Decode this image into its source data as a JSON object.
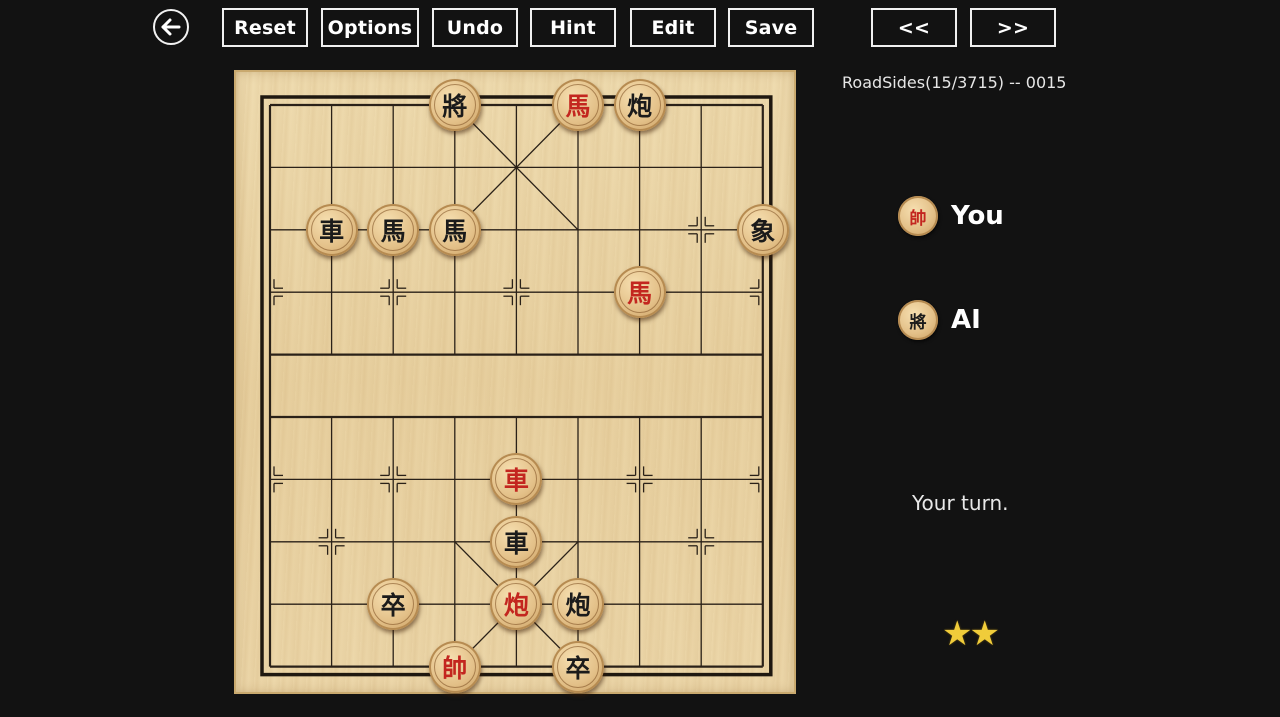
{
  "toolbar": {
    "buttons": [
      "Reset",
      "Options",
      "Undo",
      "Hint",
      "Edit",
      "Save"
    ],
    "prev_label": "<<",
    "next_label": ">>",
    "back_icon": "arrow-left-icon"
  },
  "puzzle": {
    "title": "RoadSides(15/3715) -- 0015"
  },
  "players": {
    "you": {
      "label": "You",
      "piece": "帥",
      "color": "red"
    },
    "ai": {
      "label": "AI",
      "piece": "將",
      "color": "black"
    }
  },
  "status": {
    "text": "Your turn."
  },
  "rating": {
    "stars": "★★",
    "count": 2
  },
  "board": {
    "files": 9,
    "ranks": 10,
    "pieces": [
      {
        "char": "將",
        "color": "black",
        "file": 3,
        "rank": 0
      },
      {
        "char": "馬",
        "color": "red",
        "file": 5,
        "rank": 0
      },
      {
        "char": "炮",
        "color": "black",
        "file": 6,
        "rank": 0
      },
      {
        "char": "車",
        "color": "black",
        "file": 1,
        "rank": 2
      },
      {
        "char": "馬",
        "color": "black",
        "file": 2,
        "rank": 2
      },
      {
        "char": "馬",
        "color": "black",
        "file": 3,
        "rank": 2
      },
      {
        "char": "象",
        "color": "black",
        "file": 8,
        "rank": 2
      },
      {
        "char": "馬",
        "color": "red",
        "file": 6,
        "rank": 3
      },
      {
        "char": "車",
        "color": "red",
        "file": 4,
        "rank": 6
      },
      {
        "char": "車",
        "color": "black",
        "file": 4,
        "rank": 7
      },
      {
        "char": "卒",
        "color": "black",
        "file": 2,
        "rank": 8
      },
      {
        "char": "炮",
        "color": "red",
        "file": 4,
        "rank": 8
      },
      {
        "char": "炮",
        "color": "black",
        "file": 5,
        "rank": 8
      },
      {
        "char": "帥",
        "color": "red",
        "file": 3,
        "rank": 9
      },
      {
        "char": "卒",
        "color": "black",
        "file": 5,
        "rank": 9
      }
    ]
  }
}
